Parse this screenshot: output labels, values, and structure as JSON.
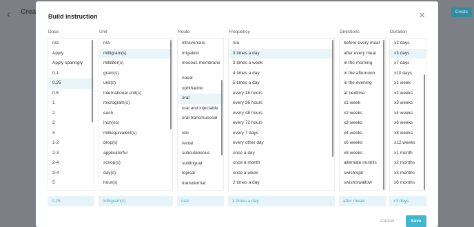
{
  "background": {
    "back_icon": "chevron-left-icon",
    "title": "Creat",
    "button": "Create"
  },
  "modal": {
    "title": "Build instruction",
    "close_icon": "close-icon",
    "cancel": "Cancel",
    "save": "Save"
  },
  "columns": [
    {
      "key": "dose",
      "header": "Dose",
      "items": [
        "n/a",
        "Apply",
        "Apply sparingly",
        "0.1",
        "0.25",
        "0.5",
        "1",
        "2",
        "3",
        "4",
        "1-2",
        "2-3",
        "2-4",
        "3-4",
        "5"
      ],
      "selected": 4,
      "summary": "0.25"
    },
    {
      "key": "unit",
      "header": "Unit",
      "items": [
        "n/a",
        "milligram(s)",
        "milliliter(s)",
        "gram(s)",
        "unit(s)",
        "international unit(s)",
        "microgram(s)",
        "each",
        "inch(es)",
        "milliequivalent(s)",
        "drop(s)",
        "applicatorful",
        "scoop(s)",
        "day(s)",
        "hour(s)"
      ],
      "selected": 1,
      "summary": "milligram(s)"
    },
    {
      "key": "route",
      "header": "Route",
      "items": [
        "intravenous",
        "irrigation",
        "mocous membrane",
        "nasal",
        "ophthalmic",
        "oral",
        "oral and injectable",
        "oral transmucosal",
        "otic",
        "rectal",
        "subcutaneous",
        "sublingual",
        "topical",
        "transdermal"
      ],
      "selected": 5,
      "summary": "oral"
    },
    {
      "key": "frequency",
      "header": "Frequency",
      "items": [
        "n/a",
        "3 times a day",
        "3 times a week",
        "4 times a day",
        "5 times a day",
        "every 18 hours",
        "every 36 hours",
        "every 48 hours",
        "every 72 hours",
        "every 7 days",
        "every other day",
        "once a day",
        "once a month",
        "once a week",
        "2 times a day"
      ],
      "selected": 1,
      "summary": "3 times a day"
    },
    {
      "key": "directions",
      "header": "Directions",
      "items": [
        "before every meal",
        "after every meal",
        "in the morning",
        "in the afternoon",
        "in the evening",
        "at bedtime",
        "x1 week",
        "x2 weeks",
        "x3 weeks",
        "x4 weeks",
        "x6 weeks",
        "x8 weeks",
        "alternate nostrils",
        "swish/spit",
        "swish/swallow"
      ],
      "selected": -1,
      "summary": "after meals"
    },
    {
      "key": "duration",
      "header": "Duration",
      "items": [
        "x2 days",
        "x3 days",
        "x7 days",
        "x10 days",
        "x1 week",
        "x2 weeks",
        "x3 weeks",
        "x4 weeks",
        "x6 weeks",
        "x8 weeks",
        "x12 weeks",
        "x1 month",
        "x2 months",
        "x3 months",
        "x6 months"
      ],
      "selected": 1,
      "summary": "x3 days"
    }
  ]
}
